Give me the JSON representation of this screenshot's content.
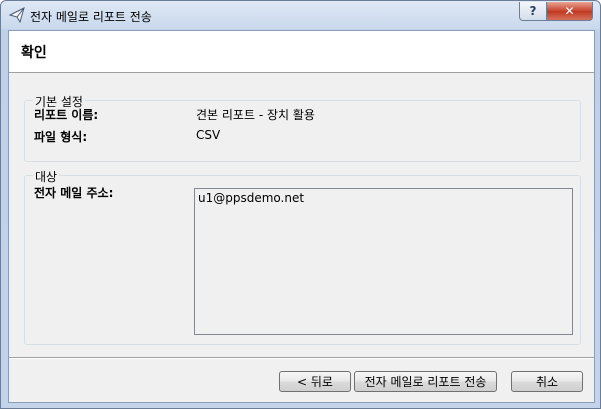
{
  "window": {
    "title": "전자 메일로 리포트 전송",
    "help_label": "?",
    "close_label": "✕"
  },
  "header": {
    "title": "확인"
  },
  "basic_settings": {
    "label": "기본 설정",
    "report_name_label": "리포트 이름:",
    "report_name_value": "견본 리포트 - 장치 활용",
    "file_format_label": "파일 형식:",
    "file_format_value": "CSV"
  },
  "target": {
    "label": "대상",
    "email_label": "전자 메일 주소:",
    "email_value": "u1@ppsdemo.net"
  },
  "buttons": {
    "back": "< 뒤로",
    "send": "전자 메일로 리포트 전송",
    "cancel": "취소"
  }
}
